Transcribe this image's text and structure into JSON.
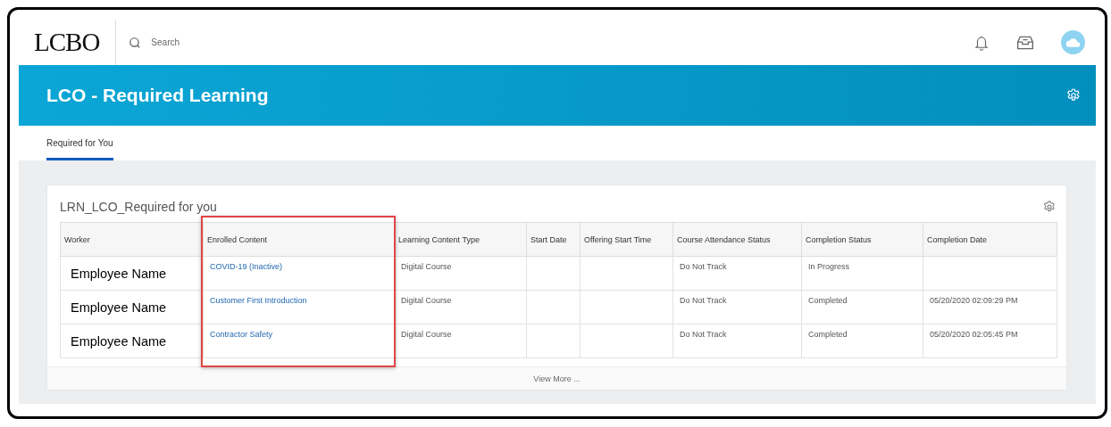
{
  "top_bar": {
    "logo": "LCBO",
    "search": {
      "placeholder": "Search"
    }
  },
  "banner": {
    "title": "LCO - Required Learning"
  },
  "tabs": [
    {
      "label": "Required for You",
      "selected": true
    }
  ],
  "card": {
    "title": "LRN_LCO_Required for you",
    "table": {
      "columns": [
        {
          "label": "Worker",
          "highlighted": false
        },
        {
          "label": "Enrolled Content",
          "highlighted": true
        },
        {
          "label": "Learning Content Type",
          "highlighted": false
        },
        {
          "label": "Start Date",
          "highlighted": false
        },
        {
          "label": "Offering Start Time",
          "highlighted": false
        },
        {
          "label": "Course Attendance Status",
          "highlighted": false
        },
        {
          "label": "Completion Status",
          "highlighted": false
        },
        {
          "label": "Completion Date",
          "highlighted": false
        }
      ],
      "rows": [
        {
          "cells": [
            "Employee Name",
            "COVID-19 (Inactive)",
            "Digital Course",
            "",
            "",
            "Do Not Track",
            "In Progress",
            ""
          ]
        },
        {
          "cells": [
            "Employee Name",
            "Customer First Introduction",
            "Digital Course",
            "",
            "",
            "Do Not Track",
            "Completed",
            "05/20/2020 02:09:29 PM"
          ]
        },
        {
          "cells": [
            "Employee Name",
            "Contractor Safety",
            "Digital Course",
            "",
            "",
            "Do Not Track",
            "Completed",
            "05/20/2020 02:05:45 PM"
          ]
        }
      ]
    },
    "footer_link": "View More ..."
  }
}
